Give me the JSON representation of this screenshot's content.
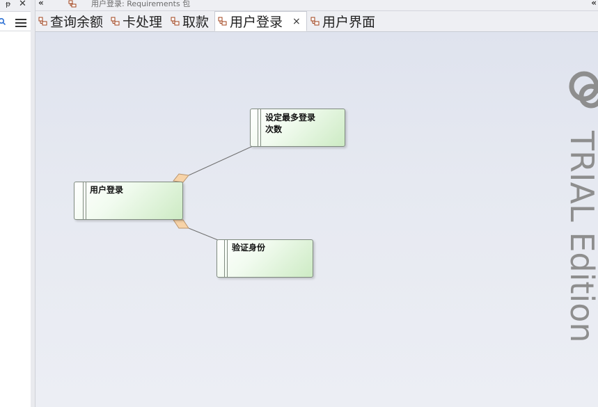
{
  "window": {
    "breadcrumb_text": "用户登录:  Requirements 包",
    "collapse_left": "«",
    "collapse_right": "«"
  },
  "left_panel": {
    "pin_glyph": "ᵽ",
    "close_glyph": "✕"
  },
  "tabs": [
    {
      "label": "查询余额",
      "active": false
    },
    {
      "label": "卡处理",
      "active": false
    },
    {
      "label": "取款",
      "active": false
    },
    {
      "label": "用户登录",
      "active": true,
      "close": "×"
    },
    {
      "label": "用户界面",
      "active": false
    }
  ],
  "diagram": {
    "nodes": [
      {
        "id": "main",
        "label": "用户登录"
      },
      {
        "id": "max-login",
        "label_line1": "设定最多登录",
        "label_line2": "次数"
      },
      {
        "id": "verify",
        "label": "验证身份"
      }
    ],
    "watermark_text": "TRIAL Edition",
    "colors": {
      "node_fill": "#cdebc4",
      "link_stroke": "#6f6f6f",
      "aggregation_diamond": "#f7d3a8",
      "watermark": "#8e8e8e"
    }
  }
}
